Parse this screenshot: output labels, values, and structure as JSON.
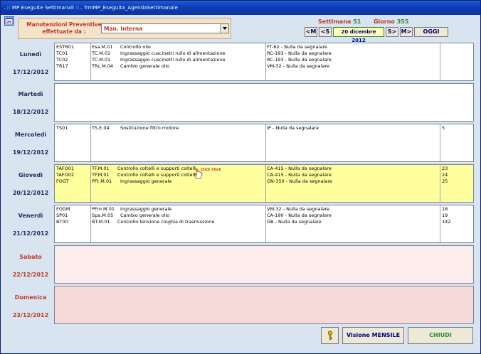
{
  "window": {
    "title": "..:: MP Eseguite Settimanali ::..   frmMP_Eseguita_AgendaSettimanale"
  },
  "filter": {
    "label": "Manutenzioni Preventive effettuate da :",
    "value": "Man. Interna"
  },
  "week": {
    "settimana_label": "Settimana",
    "settimana_value": "51",
    "giorno_label": "Giorno",
    "giorno_value": "355"
  },
  "nav": {
    "prev_month": "<M",
    "prev_week": "<S",
    "date": "20 dicembre 2012",
    "next_week": "S>",
    "next_month": "M>",
    "today": "OGGI"
  },
  "days": [
    {
      "name": "Lunedì",
      "date": "17/12/2012",
      "rows": [
        [
          "ESTR01",
          "Esa.M.01",
          "Controllo olio",
          "FT-62 - Nulla da segnalare",
          ""
        ],
        [
          "TC01",
          "TC.M.01",
          "Ingrassaggio cuscinetti rullo di alimentazione",
          "RC-193 - Nulla da segnalare",
          ""
        ],
        [
          "TC02",
          "TC.M.01",
          "Ingrassaggio cuscinetti rullo di alimentazione",
          "RC-193 - Nulla da segnalare",
          ""
        ],
        [
          "TR17",
          "TRc.M.04",
          "Cambio generale olio",
          "VM-32 - Nulla da segnalare",
          ""
        ]
      ]
    },
    {
      "name": "Martedì",
      "date": "18/12/2012",
      "rows": []
    },
    {
      "name": "Mercoledì",
      "date": "19/12/2012",
      "rows": [
        [
          "TS01",
          "TS.E.04",
          "Sostituzione filtro motore",
          "IP - Nulla da segnalare",
          "5"
        ]
      ]
    },
    {
      "name": "Giovedì",
      "date": "20/12/2012",
      "rows": [
        [
          "TAFO01",
          "TF.M.01",
          "Controllo coltelli e supporti coltelli",
          "CA-415 - Nulla da segnalare",
          "23"
        ],
        [
          "TAFO02",
          "TF.M.01",
          "Controllo coltelli e supporti coltelli",
          "CA-415 - Nulla da segnalare",
          "24"
        ],
        [
          "FOGT",
          "PFt.M.01",
          "Ingrassaggio generale",
          "GN-350 - Nulla da segnalare",
          "25"
        ]
      ]
    },
    {
      "name": "Venerdì",
      "date": "21/12/2012",
      "rows": [
        [
          "FOGM",
          "PFm.M.01",
          "Ingrassaggio generale",
          "VM-32 - Nulla da segnalare",
          "18"
        ],
        [
          "SP01",
          "Spa.M.05",
          "Cambio generale olio",
          "CA-190 - Nulla da segnalare",
          "19"
        ],
        [
          "BT00",
          "BT.M.01",
          "Controllo tensione cinghia di trasmissione",
          "GB - Nulla da segnalare",
          "142"
        ]
      ]
    },
    {
      "name": "Sabato",
      "date": "22/12/2012",
      "rows": []
    },
    {
      "name": "Domenica",
      "date": "23/12/2012",
      "rows": []
    }
  ],
  "cursor_text": "Click Click",
  "footer": {
    "monthly_label": "Visione MENSILE",
    "close_label": "CHIUDI"
  },
  "colors": {
    "title_bar": "#0a3bb0",
    "highlight_row": "#ffff9e",
    "weekend_text": "#c0392b",
    "accent_green": "#2e8b2e"
  },
  "icons": {
    "app": "calendar-window-icon",
    "help": "key-icon",
    "cursor": "pointer-hand-icon"
  }
}
